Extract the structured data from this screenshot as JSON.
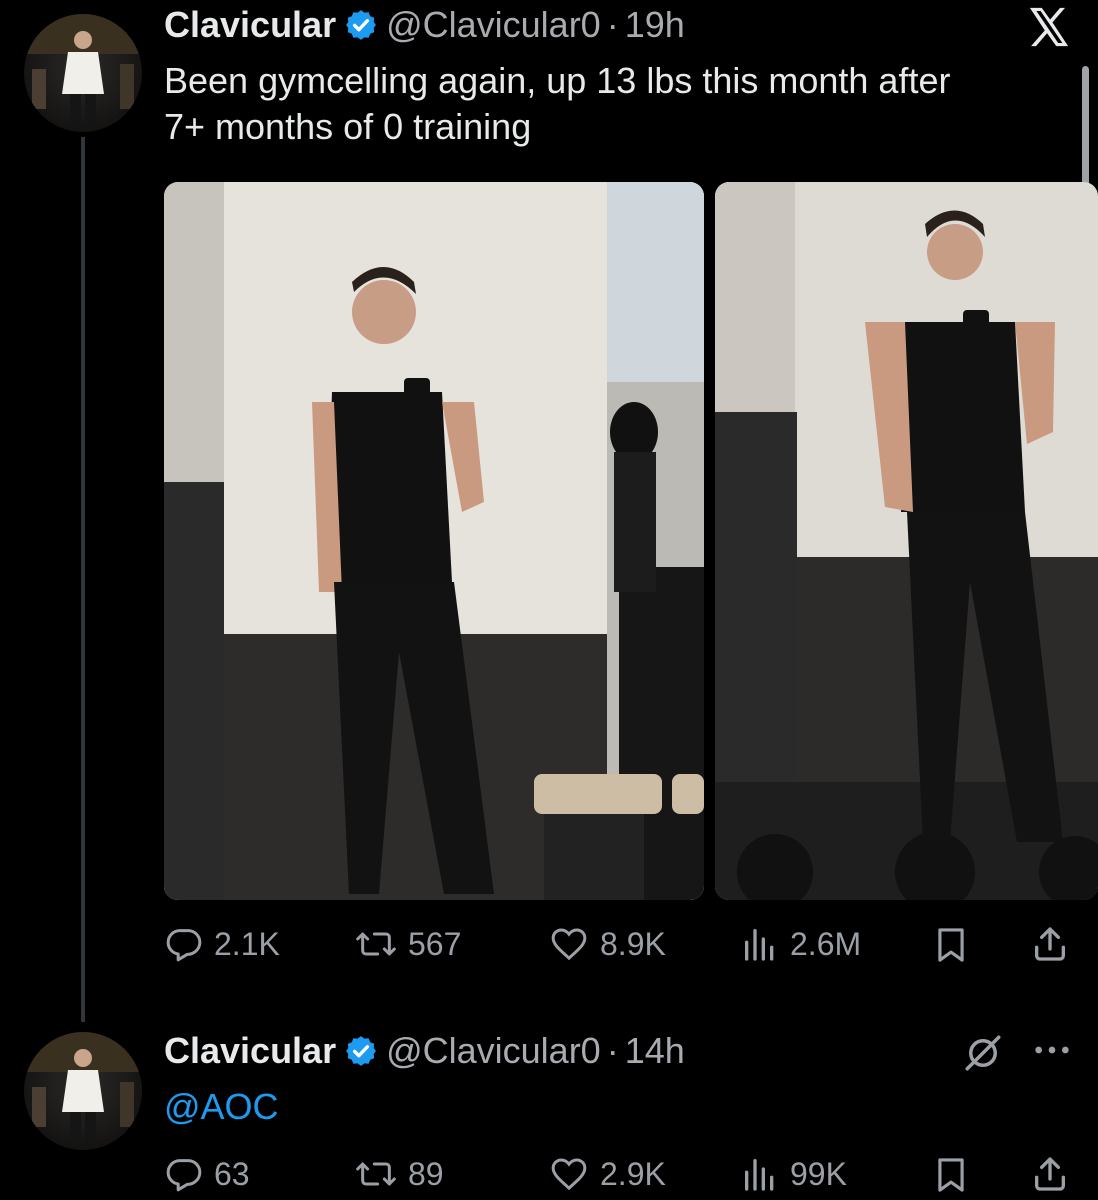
{
  "tweet1": {
    "display_name": "Clavicular",
    "handle": "@Clavicular0",
    "separator": "·",
    "time": "19h",
    "text_line1": "Been gymcelling again, up 13 lbs this month after",
    "text_line2": "7+ months of 0 training",
    "stats": {
      "replies": "2.1K",
      "reposts": "567",
      "likes": "8.9K",
      "views": "2.6M"
    }
  },
  "tweet2": {
    "display_name": "Clavicular",
    "handle": "@Clavicular0",
    "separator": "·",
    "time": "14h",
    "mention": "@AOC",
    "stats": {
      "replies": "63",
      "reposts": "89",
      "likes": "2.9K",
      "views": "99K"
    }
  },
  "colors": {
    "accent": "#1d9bf0",
    "text": "#e7e9ea",
    "muted": "#a8acb0",
    "background": "#000000"
  },
  "icons": [
    "x-logo-icon",
    "verified-badge-icon",
    "reply-icon",
    "repost-icon",
    "like-icon",
    "views-icon",
    "bookmark-icon",
    "share-icon",
    "grok-slash-icon",
    "more-icon"
  ]
}
